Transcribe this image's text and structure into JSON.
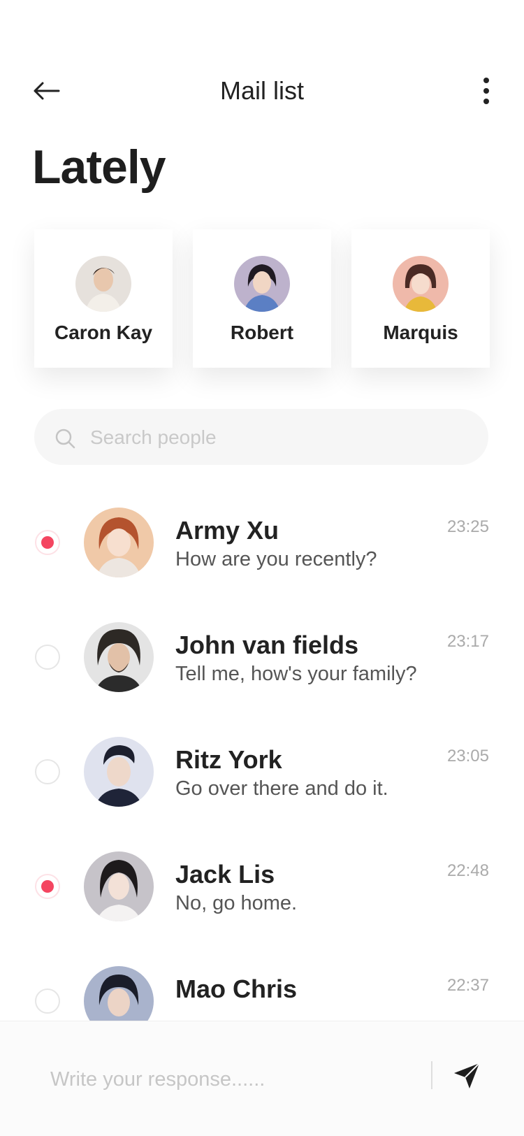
{
  "header": {
    "title": "Mail list",
    "back_icon": "arrow-left-icon",
    "more_icon": "more-vertical-icon"
  },
  "lately": {
    "title": "Lately",
    "contacts": [
      {
        "name": "Caron Kay",
        "avatar_color": "#d8d2cb"
      },
      {
        "name": "Robert",
        "avatar_color": "#b7a8c4"
      },
      {
        "name": "Marquis",
        "avatar_color": "#e8b5a6"
      }
    ]
  },
  "search": {
    "placeholder": "Search people",
    "value": ""
  },
  "messages": [
    {
      "name": "Army Xu",
      "message": "How are you recently?",
      "time": "23:25",
      "unread": true,
      "avatar_color": "#f0c9a8"
    },
    {
      "name": "John van fields",
      "message": "Tell me, how's your family?",
      "time": "23:17",
      "unread": false,
      "avatar_color": "#e2e2e2"
    },
    {
      "name": "Ritz York",
      "message": "Go over there and do it.",
      "time": "23:05",
      "unread": false,
      "avatar_color": "#d7dbe9"
    },
    {
      "name": "Jack Lis",
      "message": "No, go home.",
      "time": "22:48",
      "unread": true,
      "avatar_color": "#c9c6cc"
    },
    {
      "name": "Mao Chris",
      "message": "",
      "time": "22:37",
      "unread": false,
      "avatar_color": "#9aa6c4"
    }
  ],
  "composer": {
    "placeholder": "Write your response......",
    "value": ""
  },
  "colors": {
    "unread_dot": "#f44560",
    "text_primary": "#222222",
    "text_secondary": "#555555",
    "time": "#aaaaaa"
  }
}
